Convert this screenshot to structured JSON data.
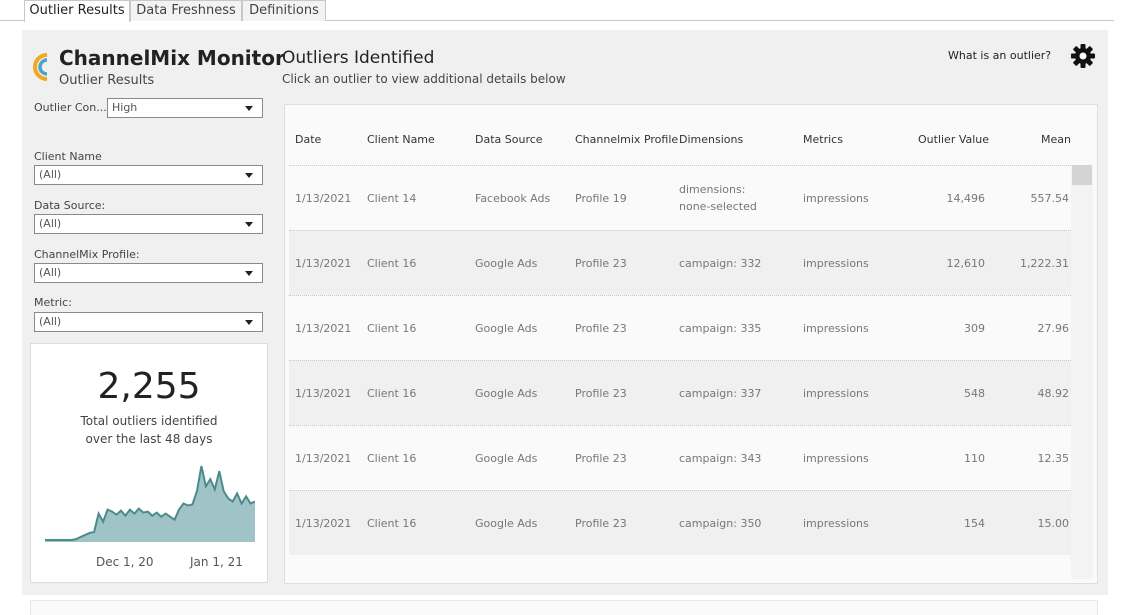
{
  "tabs": [
    {
      "label": "Outlier Results",
      "active": true
    },
    {
      "label": "Data Freshness",
      "active": false
    },
    {
      "label": "Definitions",
      "active": false
    }
  ],
  "brand": {
    "title": "ChannelMix Monitor",
    "subtitle": "Outlier Results",
    "logo_colors": [
      "#f5a623",
      "#4aa3c9"
    ]
  },
  "filters": {
    "confidence": {
      "label": "Outlier Con...",
      "value": "High"
    },
    "client_name": {
      "label": "Client Name",
      "value": "(All)"
    },
    "data_source": {
      "label": "Data Source:",
      "value": "(All)"
    },
    "profile": {
      "label": "ChannelMix Profile:",
      "value": "(All)"
    },
    "metric": {
      "label": "Metric:",
      "value": "(All)"
    }
  },
  "kpi": {
    "value": "2,255",
    "line1": "Total outliers identified",
    "line2": "over the last  48 days",
    "x_ticks": [
      "Dec 1, 20",
      "Jan 1, 21"
    ],
    "area_color": "#9fc3c6",
    "line_color": "#4d8a8e"
  },
  "chart_data": {
    "type": "area",
    "x_ticks": [
      "Dec 1, 20",
      "Jan 1, 21"
    ],
    "values": [
      2,
      2,
      2,
      2,
      2,
      2,
      2,
      3,
      5,
      7,
      9,
      10,
      28,
      20,
      32,
      30,
      27,
      31,
      26,
      32,
      28,
      33,
      29,
      30,
      26,
      29,
      25,
      28,
      25,
      22,
      32,
      38,
      36,
      37,
      50,
      75,
      55,
      62,
      52,
      70,
      50,
      43,
      40,
      48,
      38,
      45,
      38,
      40
    ]
  },
  "main": {
    "title": "Outliers Identified",
    "subtitle": "Click an outlier to view additional details below",
    "help_link": "What is an outlier?"
  },
  "table": {
    "columns": [
      "Date",
      "Client Name",
      "Data Source",
      "Channelmix Profile",
      "Dimensions",
      "Metrics",
      "Outlier Value",
      "Mean"
    ],
    "rows": [
      {
        "date": "1/13/2021",
        "client": "Client 14",
        "source": "Facebook Ads",
        "profile": "Profile 19",
        "dim1": "dimensions:",
        "dim2": "none-selected",
        "metric": "impressions",
        "value": "14,496",
        "mean": "557.54"
      },
      {
        "date": "1/13/2021",
        "client": "Client 16",
        "source": "Google Ads",
        "profile": "Profile 23",
        "dim1": "campaign: 332",
        "dim2": "",
        "metric": "impressions",
        "value": "12,610",
        "mean": "1,222.31"
      },
      {
        "date": "1/13/2021",
        "client": "Client 16",
        "source": "Google Ads",
        "profile": "Profile 23",
        "dim1": "campaign: 335",
        "dim2": "",
        "metric": "impressions",
        "value": "309",
        "mean": "27.96"
      },
      {
        "date": "1/13/2021",
        "client": "Client 16",
        "source": "Google Ads",
        "profile": "Profile 23",
        "dim1": "campaign: 337",
        "dim2": "",
        "metric": "impressions",
        "value": "548",
        "mean": "48.92"
      },
      {
        "date": "1/13/2021",
        "client": "Client 16",
        "source": "Google Ads",
        "profile": "Profile 23",
        "dim1": "campaign: 343",
        "dim2": "",
        "metric": "impressions",
        "value": "110",
        "mean": "12.35"
      },
      {
        "date": "1/13/2021",
        "client": "Client 16",
        "source": "Google Ads",
        "profile": "Profile 23",
        "dim1": "campaign: 350",
        "dim2": "",
        "metric": "impressions",
        "value": "154",
        "mean": "15.00"
      }
    ]
  }
}
